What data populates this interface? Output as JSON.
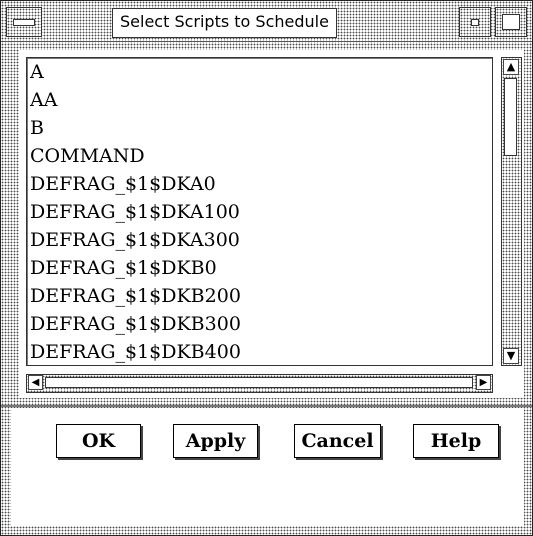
{
  "window": {
    "title": "Select Scripts to Schedule"
  },
  "list": {
    "items": [
      "A",
      "AA",
      "B",
      "COMMAND",
      "DEFRAG_$1$DKA0",
      "DEFRAG_$1$DKA100",
      "DEFRAG_$1$DKA300",
      "DEFRAG_$1$DKB0",
      "DEFRAG_$1$DKB200",
      "DEFRAG_$1$DKB300",
      "DEFRAG_$1$DKB400"
    ]
  },
  "scrollbars": {
    "vertical_position": 0,
    "horizontal_position": 0
  },
  "buttons": {
    "ok": "OK",
    "apply": "Apply",
    "cancel": "Cancel",
    "help": "Help"
  },
  "icons": {
    "window_menu": "window-menu-icon",
    "minimize": "minimize-icon",
    "maximize": "maximize-icon",
    "scroll_up": "arrow-up-icon",
    "scroll_down": "arrow-down-icon",
    "scroll_left": "arrow-left-icon",
    "scroll_right": "arrow-right-icon"
  }
}
